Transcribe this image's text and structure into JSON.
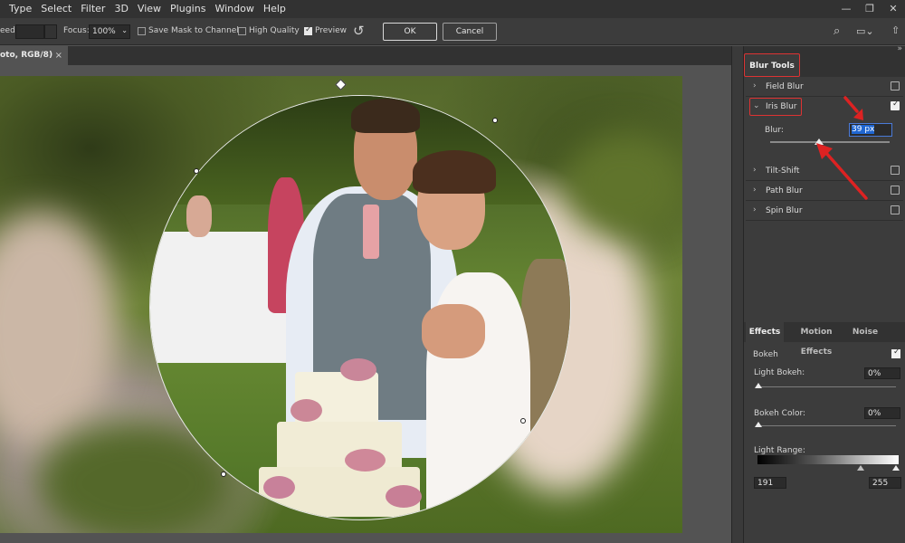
{
  "menubar": {
    "items": [
      "Type",
      "Select",
      "Filter",
      "3D",
      "View",
      "Plugins",
      "Window",
      "Help"
    ],
    "window_controls": [
      "minimize-icon",
      "restore-icon",
      "close-icon"
    ]
  },
  "options": {
    "speed_label": "eed:",
    "focus_label": "Focus:",
    "focus_value": "100%",
    "save_mask_label": "Save Mask to Channels",
    "save_mask_checked": false,
    "high_quality_label": "High Quality",
    "high_quality_checked": false,
    "preview_label": "Preview",
    "preview_checked": true,
    "ok_label": "OK",
    "cancel_label": "Cancel",
    "icons": [
      "reset-icon",
      "search-icon",
      "workspace-icon",
      "share-icon"
    ]
  },
  "document": {
    "tab_label": "oto, RGB/8)",
    "close": "×"
  },
  "blur_tools": {
    "header": "Blur Tools",
    "items": [
      {
        "label": "Field Blur",
        "checked": false,
        "expanded": false
      },
      {
        "label": "Iris Blur",
        "checked": true,
        "expanded": true
      },
      {
        "label": "Tilt-Shift",
        "checked": false,
        "expanded": false
      },
      {
        "label": "Path Blur",
        "checked": false,
        "expanded": false
      },
      {
        "label": "Spin Blur",
        "checked": false,
        "expanded": false
      }
    ],
    "blur_label": "Blur:",
    "blur_value": "39 px",
    "blur_level": 0.39
  },
  "effects": {
    "tabs": [
      "Effects",
      "Motion Effects",
      "Noise"
    ],
    "active_tab": "Effects",
    "bokeh_label": "Bokeh",
    "bokeh_checked": true,
    "light_bokeh_label": "Light Bokeh:",
    "light_bokeh_value": "0%",
    "bokeh_color_label": "Bokeh Color:",
    "bokeh_color_value": "0%",
    "light_range_label": "Light Range:",
    "light_range_low": "191",
    "light_range_high": "255"
  },
  "colors": {
    "highlight_red": "#dd2222",
    "selection_blue": "#1f66d1"
  }
}
